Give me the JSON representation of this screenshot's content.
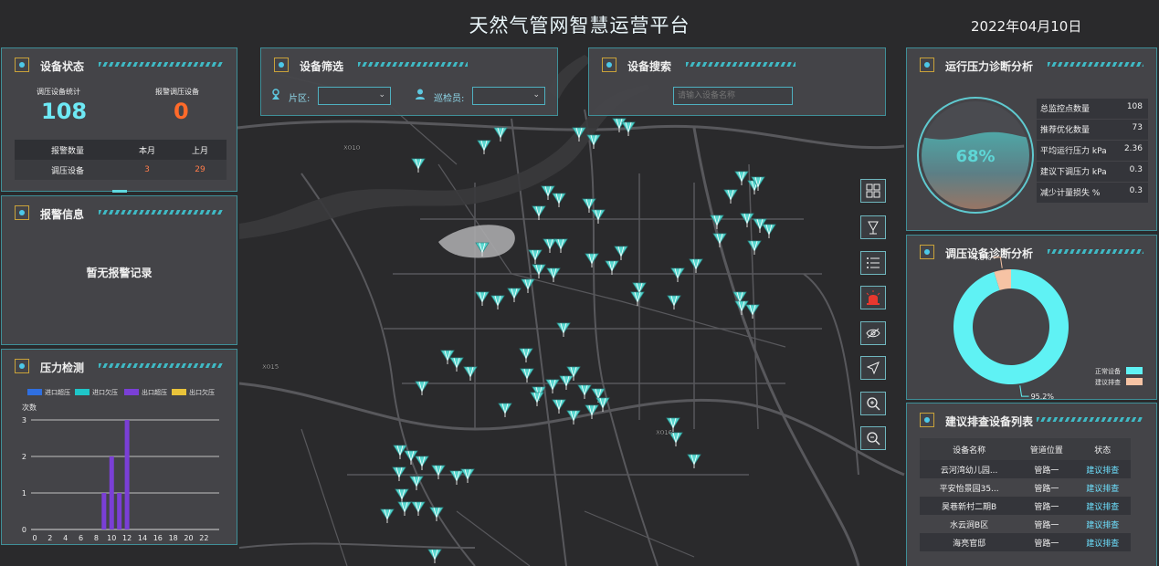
{
  "header": {
    "title": "天然气管网智慧运营平台",
    "date": "2022年04月10日"
  },
  "map": {
    "labels": [
      {
        "text": "X010"
      },
      {
        "text": "X015"
      },
      {
        "text": "X016"
      }
    ],
    "road_color": "#58585c",
    "water_color": "#a9a9ab",
    "marker_color": "#59d8d0"
  },
  "device_status": {
    "title": "设备状态",
    "regulator_label": "调压设备统计",
    "regulator_value": "108",
    "alarm_label": "报警调压设备",
    "alarm_value": "0",
    "table": {
      "headers": [
        "报警数量",
        "本月",
        "上月"
      ],
      "row": [
        "调压设备",
        "3",
        "29"
      ]
    }
  },
  "alarm_info": {
    "title": "报警信息",
    "empty_text": "暂无报警记录"
  },
  "pressure": {
    "title": "压力检测",
    "legend": [
      {
        "label": "进口超压",
        "color": "#2f6fe0"
      },
      {
        "label": "进口欠压",
        "color": "#1fc6c8"
      },
      {
        "label": "出口超压",
        "color": "#7a3fd6"
      },
      {
        "label": "出口欠压",
        "color": "#e9c33a"
      }
    ],
    "ylabel": "次数"
  },
  "chart_data": {
    "type": "bar",
    "x": [
      0,
      1,
      2,
      3,
      4,
      5,
      6,
      7,
      8,
      9,
      10,
      11,
      12,
      13,
      14,
      15,
      16,
      17,
      18,
      19,
      20,
      21,
      22,
      23
    ],
    "xticks": [
      "0",
      "2",
      "4",
      "6",
      "8",
      "10",
      "12",
      "14",
      "16",
      "18",
      "20",
      "22"
    ],
    "yticks": [
      "0",
      "1",
      "2",
      "3"
    ],
    "ylim": [
      0,
      3
    ],
    "series": [
      {
        "name": "进口超压",
        "values": [
          0,
          0,
          0,
          0,
          0,
          0,
          0,
          0,
          0,
          0,
          0,
          0,
          0,
          0,
          0,
          0,
          0,
          0,
          0,
          0,
          0,
          0,
          0,
          0
        ]
      },
      {
        "name": "进口欠压",
        "values": [
          0,
          0,
          0,
          0,
          0,
          0,
          0,
          0,
          0,
          0,
          0,
          0,
          0,
          0,
          0,
          0,
          0,
          0,
          0,
          0,
          0,
          0,
          0,
          0
        ]
      },
      {
        "name": "出口超压",
        "values": [
          0,
          0,
          0,
          0,
          0,
          0,
          0,
          0,
          0,
          1,
          2,
          1,
          3,
          0,
          0,
          0,
          0,
          0,
          0,
          0,
          0,
          0,
          0,
          0
        ]
      },
      {
        "name": "出口欠压",
        "values": [
          0,
          0,
          0,
          0,
          0,
          0,
          0,
          0,
          0,
          0,
          0,
          0,
          0,
          0,
          0,
          0,
          0,
          0,
          0,
          0,
          0,
          0,
          0,
          0
        ]
      }
    ],
    "ylabel": "次数",
    "grid": true,
    "legend": "top"
  },
  "filter": {
    "title": "设备筛选",
    "area_label": "片区:",
    "inspector_label": "巡检员:",
    "area_value": "",
    "inspector_value": ""
  },
  "search": {
    "title": "设备搜索",
    "placeholder": "请输入设备名称"
  },
  "toolbar": {
    "layers": "layers-icon",
    "marker": "marker-icon",
    "list": "list-icon",
    "alarm": "alarm-light-icon",
    "eye": "eye-off-icon",
    "locate": "locate-icon",
    "zoom_in": "zoom-in-icon",
    "zoom_out": "zoom-out-icon"
  },
  "diagnosis": {
    "title": "运行压力诊断分析",
    "percent": "68%",
    "percent_value": 0.68,
    "stats": [
      {
        "label": "总监控点数量",
        "value": "108"
      },
      {
        "label": "推荐优化数量",
        "value": "73"
      },
      {
        "label": "平均运行压力 kPa",
        "value": "2.36"
      },
      {
        "label": "建议下调压力 kPa",
        "value": "0.3"
      },
      {
        "label": "减少计量损失 %",
        "value": "0.3"
      }
    ]
  },
  "regulator_diag": {
    "title": "调压设备诊断分析",
    "slices": [
      {
        "label": "正常设备",
        "value": 95.2,
        "text": "95.2%",
        "color": "#5ff2f4"
      },
      {
        "label": "建议排查",
        "value": 4.8,
        "text": "4.8%",
        "color": "#f6c3a4"
      }
    ]
  },
  "suggest_list": {
    "title": "建议排查设备列表",
    "headers": [
      "设备名称",
      "管道位置",
      "状态"
    ],
    "rows": [
      [
        "云河湾幼儿园...",
        "管路一",
        "建议排查"
      ],
      [
        "平安怡景园35...",
        "管路一",
        "建议排查"
      ],
      [
        "昊巷新村二期B",
        "管路一",
        "建议排查"
      ],
      [
        "水云涧B区",
        "管路一",
        "建议排查"
      ],
      [
        "海亮官邸",
        "管路一",
        "建议排查"
      ]
    ]
  }
}
